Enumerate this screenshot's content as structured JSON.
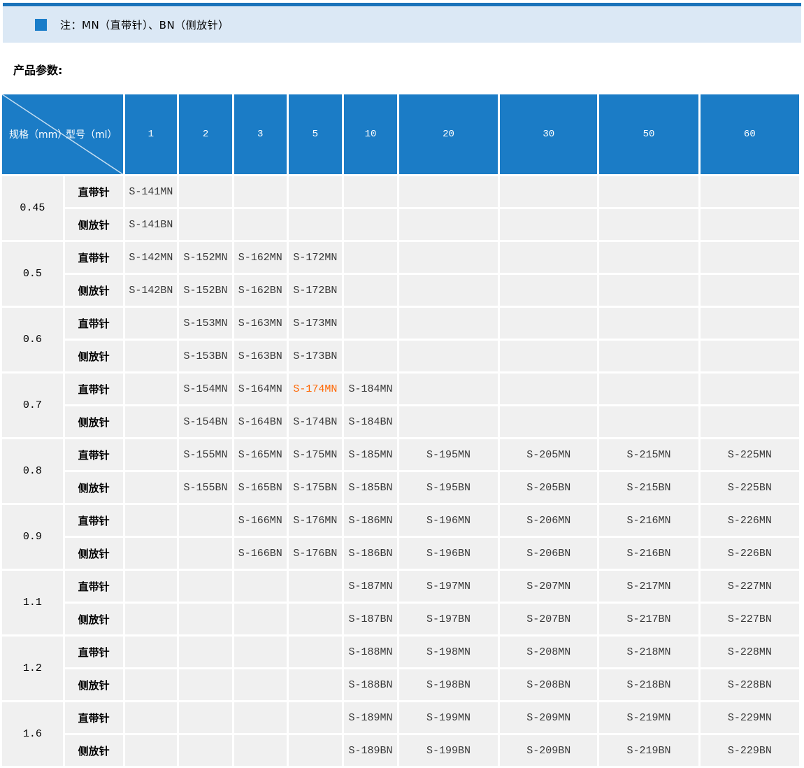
{
  "note": {
    "text": "注：MN（直带针）、BN（侧放针）"
  },
  "section_title": "产品参数:",
  "table": {
    "corner": {
      "row_label": "规格（mm）",
      "col_label": "型号（ml）"
    },
    "columns": [
      "1",
      "2",
      "3",
      "5",
      "10",
      "20",
      "30",
      "50",
      "60"
    ],
    "row_types": [
      "直带针",
      "侧放针"
    ],
    "groups": [
      {
        "spec": "0.45",
        "mn": [
          "S-141MN",
          "",
          "",
          "",
          "",
          "",
          "",
          "",
          ""
        ],
        "bn": [
          "S-141BN",
          "",
          "",
          "",
          "",
          "",
          "",
          "",
          ""
        ]
      },
      {
        "spec": "0.5",
        "mn": [
          "S-142MN",
          "S-152MN",
          "S-162MN",
          "S-172MN",
          "",
          "",
          "",
          "",
          ""
        ],
        "bn": [
          "S-142BN",
          "S-152BN",
          "S-162BN",
          "S-172BN",
          "",
          "",
          "",
          "",
          ""
        ]
      },
      {
        "spec": "0.6",
        "mn": [
          "",
          "S-153MN",
          "S-163MN",
          "S-173MN",
          "",
          "",
          "",
          "",
          ""
        ],
        "bn": [
          "",
          "S-153BN",
          "S-163BN",
          "S-173BN",
          "",
          "",
          "",
          "",
          ""
        ]
      },
      {
        "spec": "0.7",
        "mn": [
          "",
          "S-154MN",
          "S-164MN",
          "S-174MN",
          "S-184MN",
          "",
          "",
          "",
          ""
        ],
        "bn": [
          "",
          "S-154BN",
          "S-164BN",
          "S-174BN",
          "S-184BN",
          "",
          "",
          "",
          ""
        ]
      },
      {
        "spec": "0.8",
        "mn": [
          "",
          "S-155MN",
          "S-165MN",
          "S-175MN",
          "S-185MN",
          "S-195MN",
          "S-205MN",
          "S-215MN",
          "S-225MN"
        ],
        "bn": [
          "",
          "S-155BN",
          "S-165BN",
          "S-175BN",
          "S-185BN",
          "S-195BN",
          "S-205BN",
          "S-215BN",
          "S-225BN"
        ]
      },
      {
        "spec": "0.9",
        "mn": [
          "",
          "",
          "S-166MN",
          "S-176MN",
          "S-186MN",
          "S-196MN",
          "S-206MN",
          "S-216MN",
          "S-226MN"
        ],
        "bn": [
          "",
          "",
          "S-166BN",
          "S-176BN",
          "S-186BN",
          "S-196BN",
          "S-206BN",
          "S-216BN",
          "S-226BN"
        ]
      },
      {
        "spec": "1.1",
        "mn": [
          "",
          "",
          "",
          "",
          "S-187MN",
          "S-197MN",
          "S-207MN",
          "S-217MN",
          "S-227MN"
        ],
        "bn": [
          "",
          "",
          "",
          "",
          "S-187BN",
          "S-197BN",
          "S-207BN",
          "S-217BN",
          "S-227BN"
        ]
      },
      {
        "spec": "1.2",
        "mn": [
          "",
          "",
          "",
          "",
          "S-188MN",
          "S-198MN",
          "S-208MN",
          "S-218MN",
          "S-228MN"
        ],
        "bn": [
          "",
          "",
          "",
          "",
          "S-188BN",
          "S-198BN",
          "S-208BN",
          "S-218BN",
          "S-228BN"
        ]
      },
      {
        "spec": "1.6",
        "mn": [
          "",
          "",
          "",
          "",
          "S-189MN",
          "S-199MN",
          "S-209MN",
          "S-219MN",
          "S-229MN"
        ],
        "bn": [
          "",
          "",
          "",
          "",
          "S-189BN",
          "S-199BN",
          "S-209BN",
          "S-219BN",
          "S-229BN"
        ]
      }
    ],
    "highlight": {
      "code": "S-174MN",
      "color": "#ff6600"
    }
  },
  "colors": {
    "header_bg": "#1b7cc6",
    "top_line": "#1a73ba",
    "note_band_bg": "#dbe8f5",
    "accent_bullet": "#1a7dc9",
    "cell_bg": "#f0f0f0",
    "code_text": "#383838",
    "highlight_text": "#ff6600"
  }
}
